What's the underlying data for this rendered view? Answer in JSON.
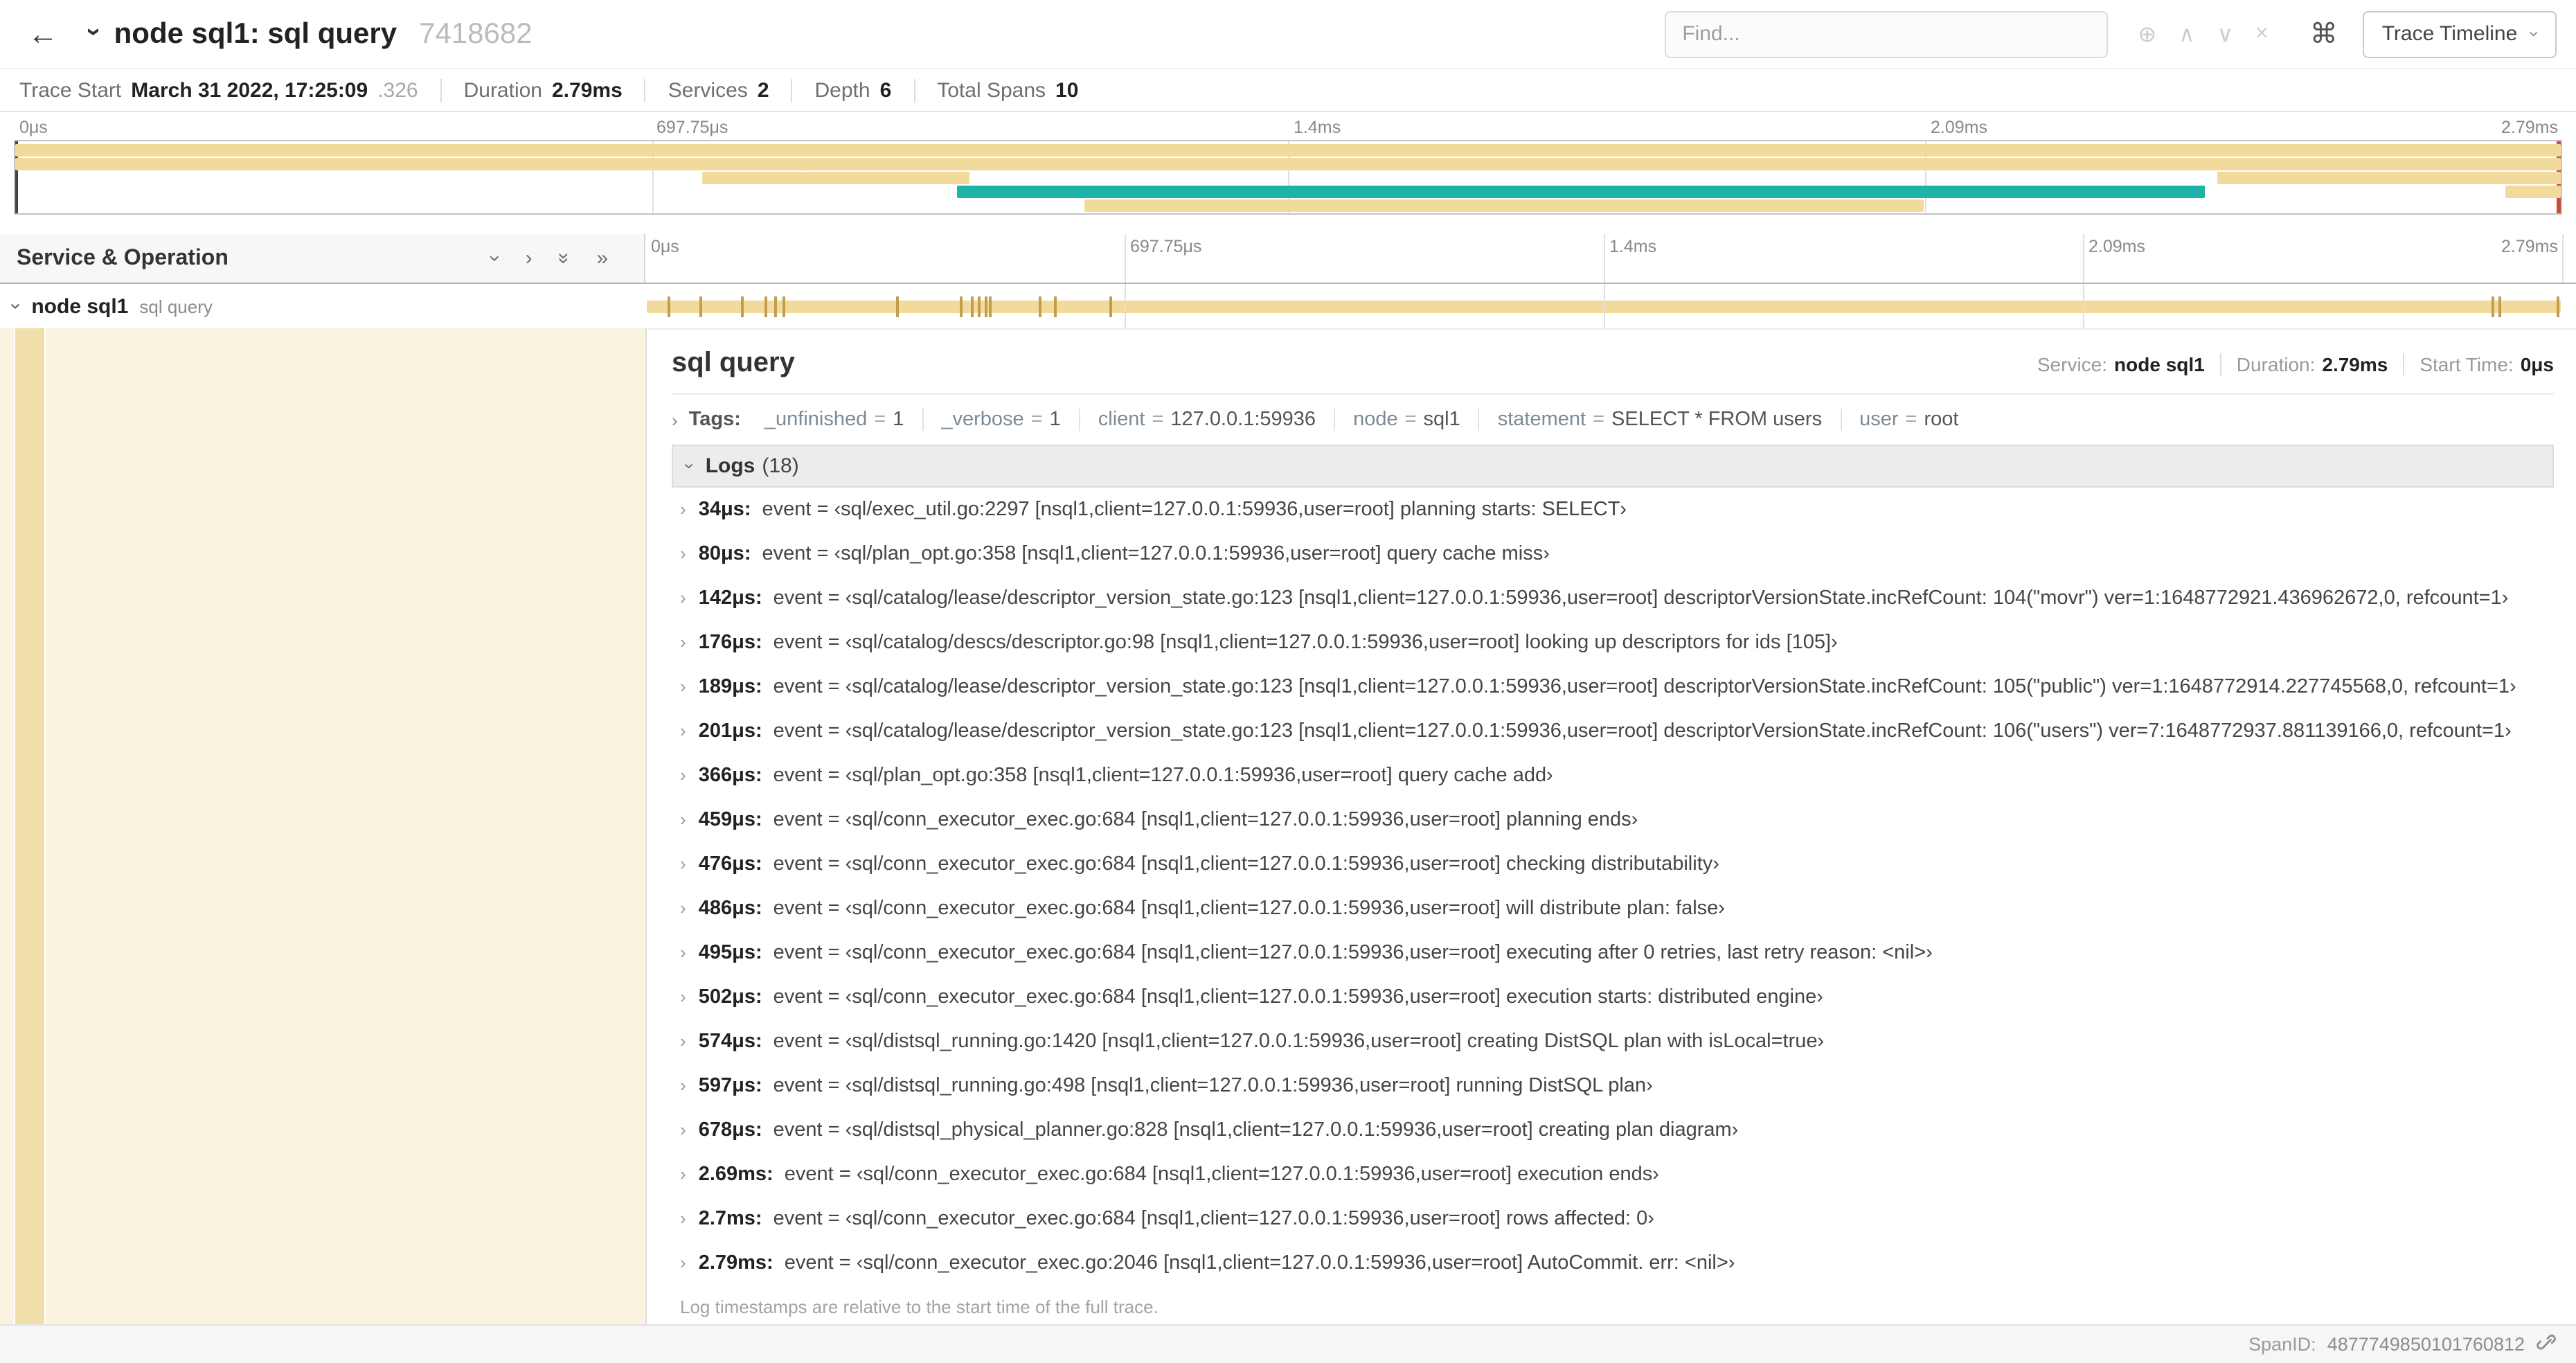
{
  "header": {
    "title": "node sql1: sql query",
    "trace_id": "7418682",
    "find_placeholder": "Find...",
    "view_dropdown": "Trace Timeline"
  },
  "icons": {
    "back": "←",
    "chevron": "›",
    "double_chevron": "»",
    "circle_plus": "⊕",
    "prev_match": "∧",
    "next_match": "∨",
    "clear": "×",
    "command": "⌘"
  },
  "summary": {
    "items": [
      {
        "label": "Trace Start",
        "value": "March 31 2022, 17:25:09",
        "dim": ".326"
      },
      {
        "label": "Duration",
        "value": "2.79ms"
      },
      {
        "label": "Services",
        "value": "2"
      },
      {
        "label": "Depth",
        "value": "6"
      },
      {
        "label": "Total Spans",
        "value": "10"
      }
    ]
  },
  "timeline": {
    "total_us": 2790,
    "ticks": [
      {
        "label": "0μs",
        "p": 0
      },
      {
        "label": "697.75μs",
        "p": 25
      },
      {
        "label": "1.4ms",
        "p": 50
      },
      {
        "label": "2.09ms",
        "p": 75
      },
      {
        "label": "2.79ms",
        "p": 100
      }
    ]
  },
  "minimap": {
    "colors": {
      "span_bar": "#F2DA9C",
      "accent": "#1DB3A7",
      "marker": "#BE9A48",
      "cursor": "#C74A3E"
    },
    "bars": [
      {
        "r": 0,
        "l": 0,
        "w": 100,
        "c": "span"
      },
      {
        "r": 1,
        "l": 0,
        "w": 100,
        "c": "span"
      },
      {
        "r": 2,
        "l": 27,
        "w": 4,
        "c": "span"
      },
      {
        "r": 2,
        "l": 31,
        "w": 6.5,
        "c": "span"
      },
      {
        "r": 3,
        "l": 37,
        "w": 49,
        "c": "teal"
      },
      {
        "r": 4,
        "l": 42,
        "w": 33,
        "c": "span"
      },
      {
        "r": 2,
        "l": 86.5,
        "w": 13.5,
        "c": "span"
      },
      {
        "r": 3,
        "l": 97.8,
        "w": 2.2,
        "c": "span"
      }
    ]
  },
  "left_header": {
    "title": "Service & Operation"
  },
  "span_row": {
    "service": "node sql1",
    "operation": "sql query"
  },
  "detail": {
    "title": "sql query",
    "meta": [
      {
        "label": "Service:",
        "value": "node sql1"
      },
      {
        "label": "Duration:",
        "value": "2.79ms"
      },
      {
        "label": "Start Time:",
        "value": "0μs"
      }
    ],
    "tags_label": "Tags:",
    "tags_eq": "=",
    "tags": [
      {
        "key": "_unfinished",
        "value": "1"
      },
      {
        "key": "_verbose",
        "value": "1"
      },
      {
        "key": "client",
        "value": "127.0.0.1:59936"
      },
      {
        "key": "node",
        "value": "sql1"
      },
      {
        "key": "statement",
        "value": "SELECT * FROM users"
      },
      {
        "key": "user",
        "value": "root"
      }
    ],
    "logs_label": "Logs",
    "logs_count": "(18)",
    "logs": [
      {
        "t": "34μs:",
        "t_us": 34,
        "text": "event = ‹sql/exec_util.go:2297 [nsql1,client=127.0.0.1:59936,user=root] planning starts: SELECT›"
      },
      {
        "t": "80μs:",
        "t_us": 80,
        "text": "event = ‹sql/plan_opt.go:358 [nsql1,client=127.0.0.1:59936,user=root] query cache miss›"
      },
      {
        "t": "142μs:",
        "t_us": 142,
        "text": "event = ‹sql/catalog/lease/descriptor_version_state.go:123 [nsql1,client=127.0.0.1:59936,user=root] descriptorVersionState.incRefCount: 104(\"movr\") ver=1:1648772921.436962672,0, refcount=1›"
      },
      {
        "t": "176μs:",
        "t_us": 176,
        "text": "event = ‹sql/catalog/descs/descriptor.go:98 [nsql1,client=127.0.0.1:59936,user=root] looking up descriptors for ids [105]›"
      },
      {
        "t": "189μs:",
        "t_us": 189,
        "text": "event = ‹sql/catalog/lease/descriptor_version_state.go:123 [nsql1,client=127.0.0.1:59936,user=root] descriptorVersionState.incRefCount: 105(\"public\") ver=1:1648772914.227745568,0, refcount=1›"
      },
      {
        "t": "201μs:",
        "t_us": 201,
        "text": "event = ‹sql/catalog/lease/descriptor_version_state.go:123 [nsql1,client=127.0.0.1:59936,user=root] descriptorVersionState.incRefCount: 106(\"users\") ver=7:1648772937.881139166,0, refcount=1›"
      },
      {
        "t": "366μs:",
        "t_us": 366,
        "text": "event = ‹sql/plan_opt.go:358 [nsql1,client=127.0.0.1:59936,user=root] query cache add›"
      },
      {
        "t": "459μs:",
        "t_us": 459,
        "text": "event = ‹sql/conn_executor_exec.go:684 [nsql1,client=127.0.0.1:59936,user=root] planning ends›"
      },
      {
        "t": "476μs:",
        "t_us": 476,
        "text": "event = ‹sql/conn_executor_exec.go:684 [nsql1,client=127.0.0.1:59936,user=root] checking distributability›"
      },
      {
        "t": "486μs:",
        "t_us": 486,
        "text": "event = ‹sql/conn_executor_exec.go:684 [nsql1,client=127.0.0.1:59936,user=root] will distribute plan: false›"
      },
      {
        "t": "495μs:",
        "t_us": 495,
        "text": "event = ‹sql/conn_executor_exec.go:684 [nsql1,client=127.0.0.1:59936,user=root] executing after 0 retries, last retry reason: <nil>›"
      },
      {
        "t": "502μs:",
        "t_us": 502,
        "text": "event = ‹sql/conn_executor_exec.go:684 [nsql1,client=127.0.0.1:59936,user=root] execution starts: distributed engine›"
      },
      {
        "t": "574μs:",
        "t_us": 574,
        "text": "event = ‹sql/distsql_running.go:1420 [nsql1,client=127.0.0.1:59936,user=root] creating DistSQL plan with isLocal=true›"
      },
      {
        "t": "597μs:",
        "t_us": 597,
        "text": "event = ‹sql/distsql_running.go:498 [nsql1,client=127.0.0.1:59936,user=root] running DistSQL plan›"
      },
      {
        "t": "678μs:",
        "t_us": 678,
        "text": "event = ‹sql/distsql_physical_planner.go:828 [nsql1,client=127.0.0.1:59936,user=root] creating plan diagram›"
      },
      {
        "t": "2.69ms:",
        "t_us": 2690,
        "text": "event = ‹sql/conn_executor_exec.go:684 [nsql1,client=127.0.0.1:59936,user=root] execution ends›"
      },
      {
        "t": "2.7ms:",
        "t_us": 2700,
        "text": "event = ‹sql/conn_executor_exec.go:684 [nsql1,client=127.0.0.1:59936,user=root] rows affected: 0›"
      },
      {
        "t": "2.79ms:",
        "t_us": 2790,
        "text": "event = ‹sql/conn_executor_exec.go:2046 [nsql1,client=127.0.0.1:59936,user=root] AutoCommit. err: <nil>›"
      }
    ],
    "logs_note": "Log timestamps are relative to the start time of the full trace.",
    "span_id_label": "SpanID:",
    "span_id": "4877749850101760812"
  }
}
